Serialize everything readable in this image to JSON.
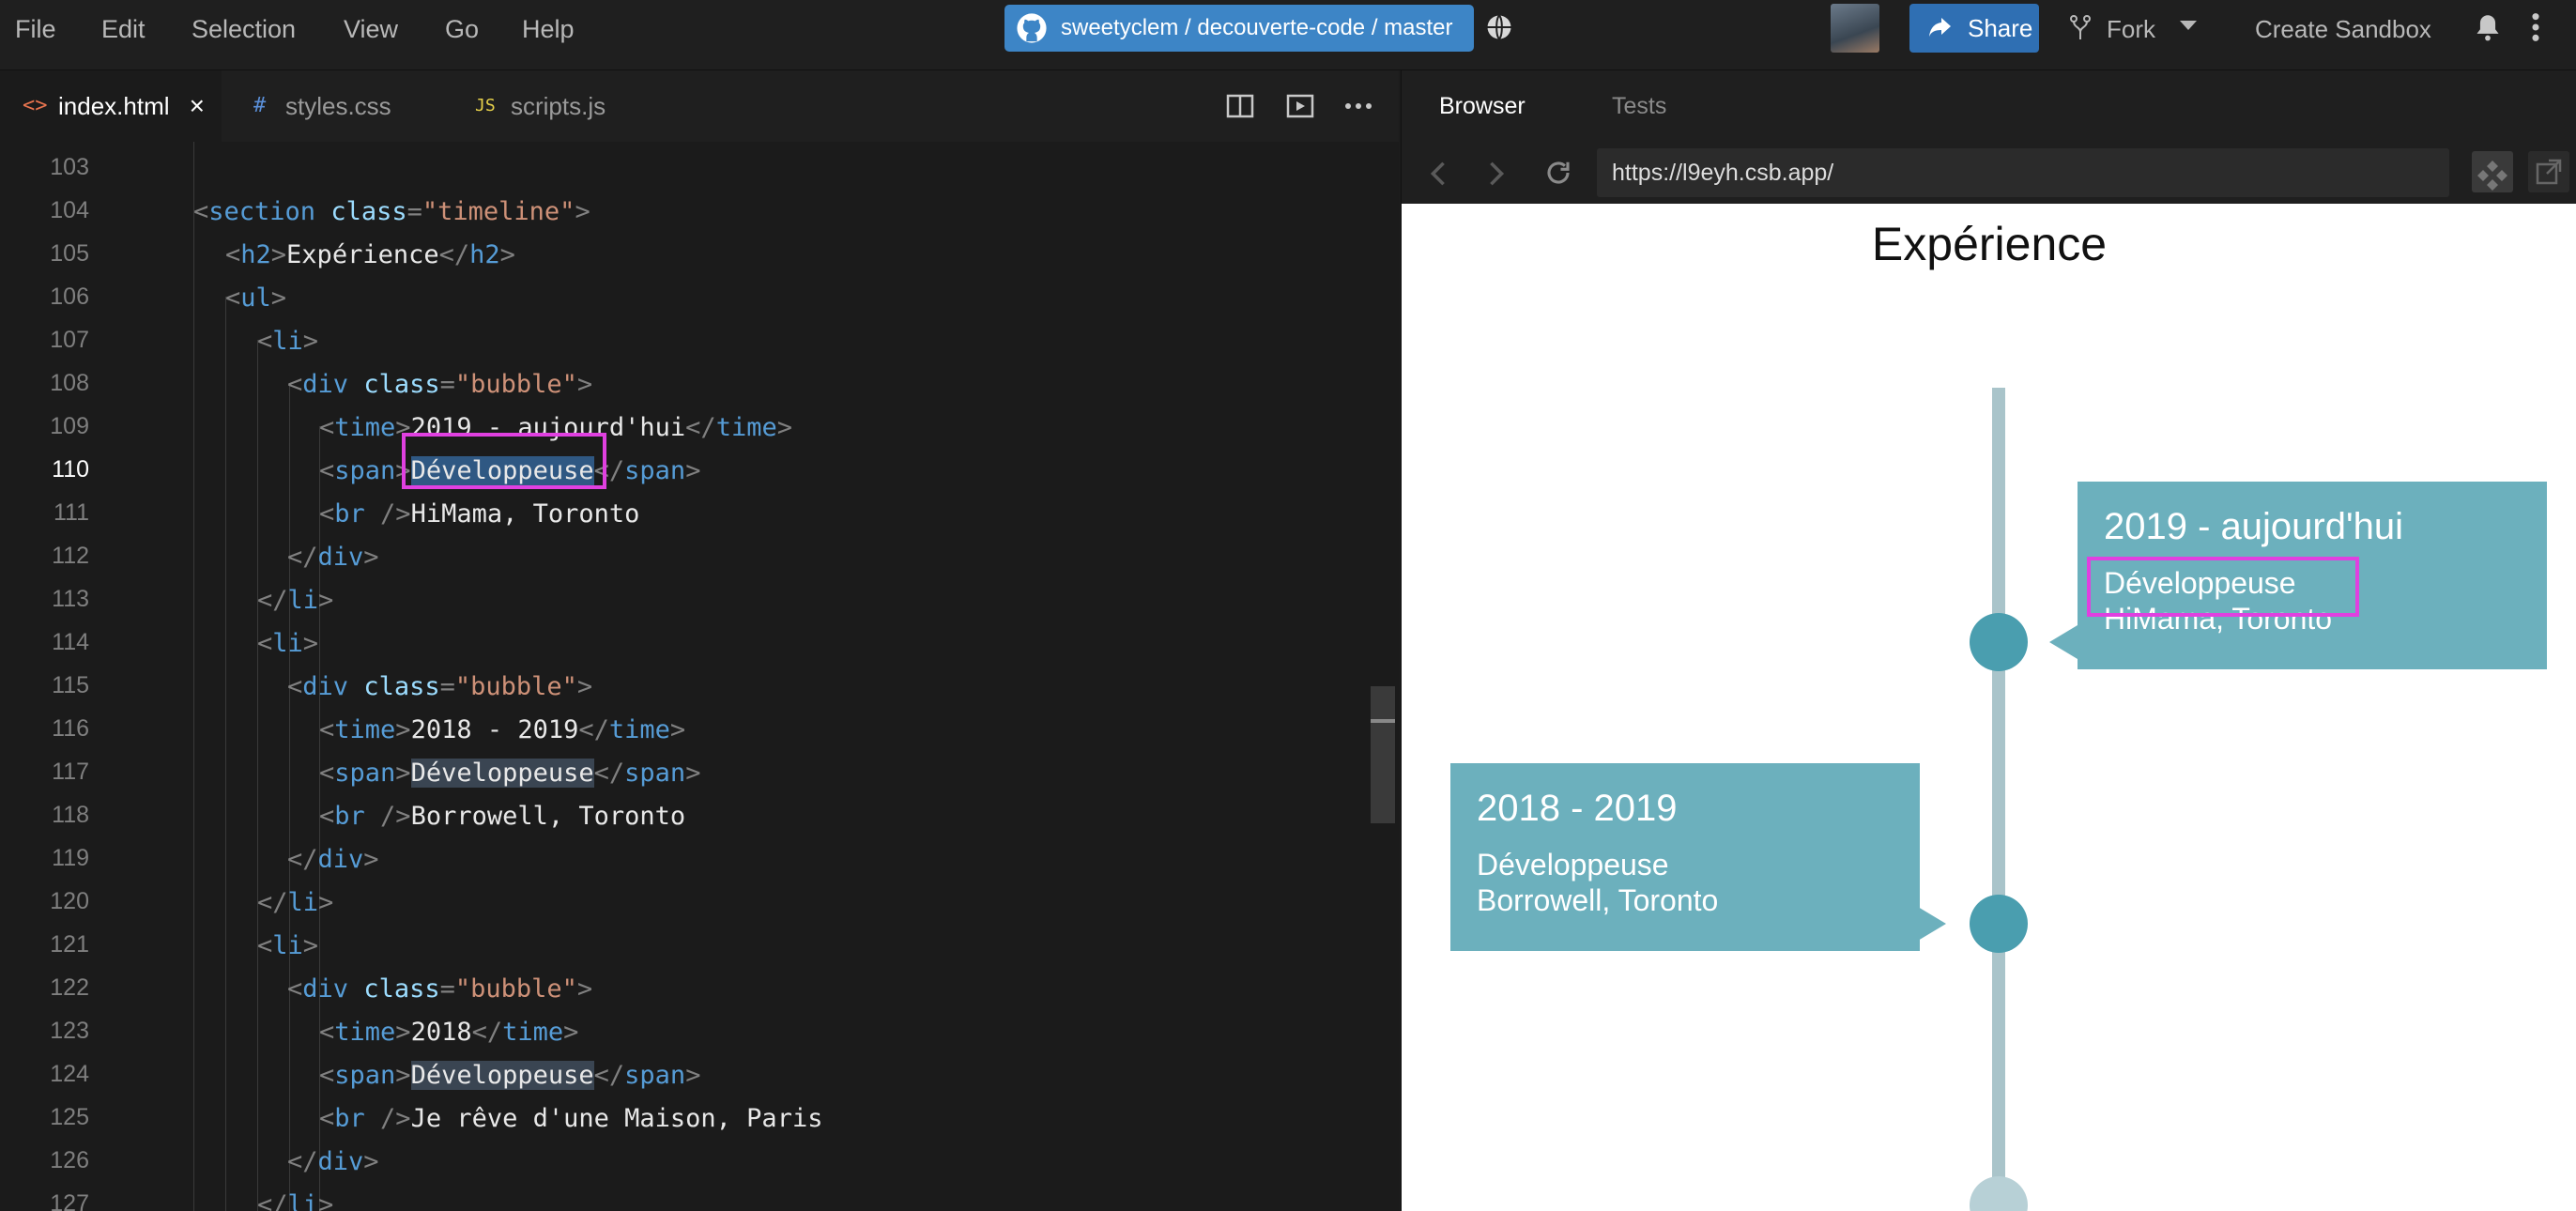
{
  "menu": [
    "File",
    "Edit",
    "Selection",
    "View",
    "Go",
    "Help"
  ],
  "repo": {
    "label": "sweetyclem / decouverte-code / master"
  },
  "header": {
    "share": "Share",
    "fork": "Fork",
    "create_sandbox": "Create Sandbox"
  },
  "tabs": [
    {
      "icon": "<>",
      "label": "index.html",
      "close": "×"
    },
    {
      "icon": "#",
      "label": "styles.css"
    },
    {
      "icon": "JS",
      "label": "scripts.js"
    }
  ],
  "editor": {
    "current_line": 110,
    "line_numbers": [
      "103",
      "104",
      "105",
      "106",
      "107",
      "108",
      "109",
      "110",
      "111",
      "112",
      "113",
      "114",
      "115",
      "116",
      "117",
      "118",
      "119",
      "120",
      "121",
      "122",
      "123",
      "124",
      "125",
      "126",
      "127"
    ]
  },
  "preview": {
    "tabs": [
      "Browser",
      "Tests"
    ],
    "url": "https://l9eyh.csb.app/",
    "heading": "Expérience",
    "timeline": [
      {
        "when": "2019 - aujourd'hui",
        "role": "Développeuse",
        "place": "HiMama, Toronto"
      },
      {
        "when": "2018 - 2019",
        "role": "Développeuse",
        "place": "Borrowell, Toronto"
      }
    ]
  },
  "colors": {
    "accent_blue": "#3d85c6",
    "highlight_magenta": "#e040e0",
    "bubble_teal": "#6cb0bd",
    "dot_teal": "#4a9eaf"
  }
}
